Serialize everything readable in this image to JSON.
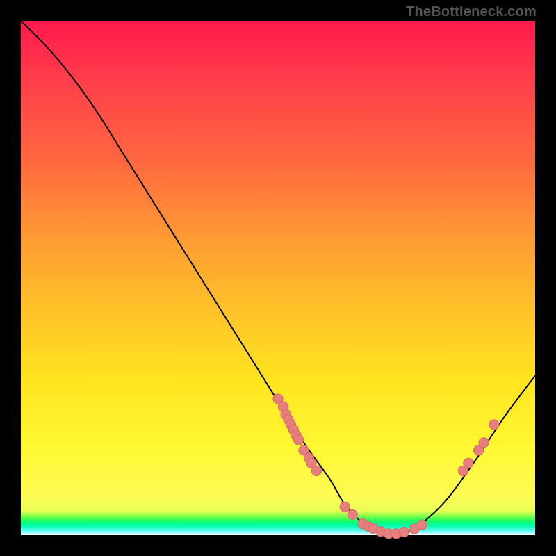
{
  "attribution": "TheBottleneck.com",
  "colors": {
    "curve": "#000000",
    "dot_fill": "#e77f7f",
    "dot_stroke": "#d96b6b"
  },
  "chart_data": {
    "type": "line",
    "title": "",
    "xlabel": "",
    "ylabel": "",
    "xlim": [
      0,
      100
    ],
    "ylim": [
      0,
      100
    ],
    "grid": false,
    "legend": false,
    "series": [
      {
        "name": "bottleneck-curve",
        "x": [
          0,
          5,
          10,
          15,
          20,
          25,
          30,
          35,
          40,
          45,
          50,
          55,
          60,
          63,
          67,
          72,
          76,
          82,
          88,
          94,
          100
        ],
        "y": [
          100,
          95,
          89,
          82,
          74,
          66,
          58,
          50,
          42,
          34,
          26,
          18,
          11,
          6,
          2,
          0,
          1,
          6,
          14,
          23,
          31
        ]
      }
    ],
    "markers": [
      {
        "name": "cluster-left",
        "points": [
          [
            50,
            26.5
          ],
          [
            51,
            25
          ],
          [
            51.5,
            23.5
          ],
          [
            52,
            22.5
          ],
          [
            52.5,
            21.5
          ],
          [
            53,
            20.5
          ],
          [
            53.5,
            19.5
          ],
          [
            54,
            18.5
          ],
          [
            55,
            16.5
          ],
          [
            56,
            15
          ],
          [
            56.5,
            14
          ],
          [
            57.5,
            12.5
          ]
        ]
      },
      {
        "name": "cluster-bottom",
        "points": [
          [
            63,
            5.5
          ],
          [
            64.5,
            4
          ],
          [
            66.5,
            2.2
          ],
          [
            67.5,
            1.7
          ],
          [
            68.5,
            1.3
          ],
          [
            70,
            0.7
          ],
          [
            71.5,
            0.3
          ],
          [
            73,
            0.3
          ],
          [
            74.5,
            0.6
          ],
          [
            76.5,
            1.2
          ],
          [
            78,
            2
          ]
        ]
      },
      {
        "name": "cluster-right",
        "points": [
          [
            86,
            12.5
          ],
          [
            87,
            14
          ],
          [
            89,
            16.5
          ],
          [
            90,
            18
          ],
          [
            92,
            21.5
          ]
        ]
      }
    ]
  }
}
